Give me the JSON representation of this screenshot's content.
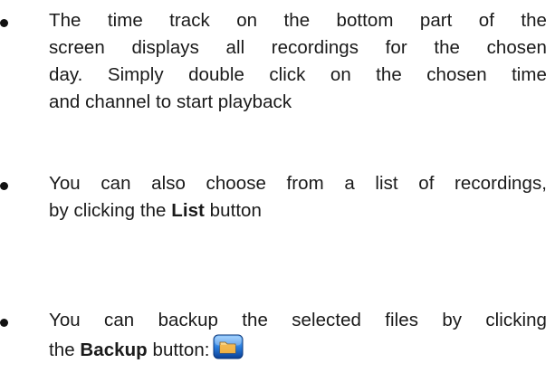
{
  "bullets": [
    {
      "lines": [
        "The time track on the bottom part of the",
        "screen displays all recordings for the chosen",
        "day. Simply double click on the chosen time",
        "and channel to start playback"
      ]
    },
    {
      "lines": [
        "You can also choose from a list of recordings,",
        "by clicking the "
      ],
      "bold_term": "List",
      "after_bold": " button"
    },
    {
      "lines": [
        "You can backup the selected files by clicking",
        "the "
      ],
      "bold_term": "Backup",
      "after_bold": " button:",
      "icon": "backup-folder-icon"
    }
  ],
  "colors": {
    "text": "#1a1a1a",
    "icon_blue": "#1f6fd1",
    "icon_folder": "#e2a93a"
  }
}
